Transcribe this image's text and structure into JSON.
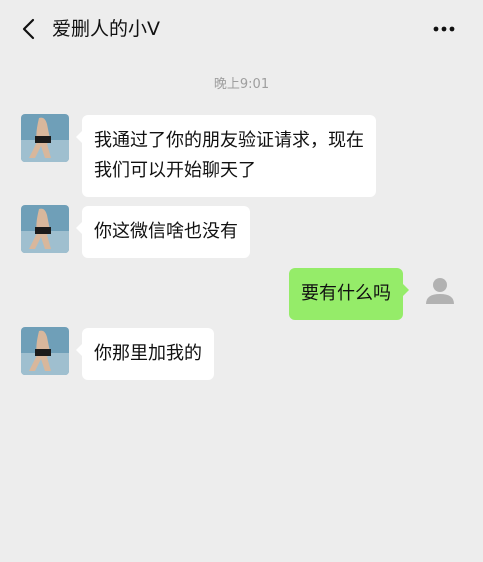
{
  "header": {
    "back_icon": "chevron-left-icon",
    "title": "爱删人的小V",
    "more_icon": "more-horizontal-icon"
  },
  "chat": {
    "timestamp": "晚上9:01",
    "messages": [
      {
        "side": "left",
        "text_lines": [
          "我通过了你的朋友验证请求，现在",
          "我们可以开始聊天了"
        ]
      },
      {
        "side": "left",
        "text": "你这微信啥也没有"
      },
      {
        "side": "right",
        "text": "要有什么吗"
      },
      {
        "side": "left",
        "text": "你那里加我的"
      }
    ]
  },
  "colors": {
    "background": "#ededed",
    "bubble_left": "#ffffff",
    "bubble_right": "#95ec69",
    "timestamp": "#9e9e9e"
  }
}
